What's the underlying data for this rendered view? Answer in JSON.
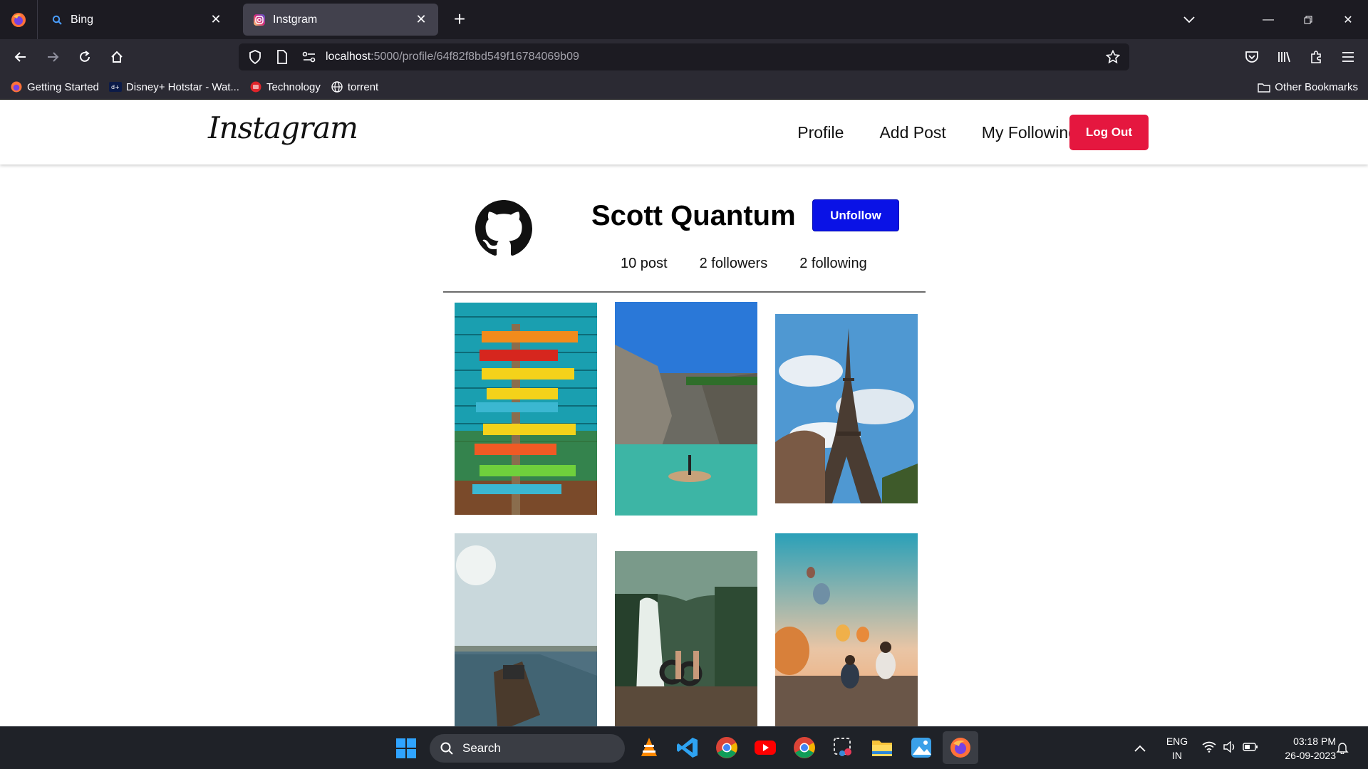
{
  "browser": {
    "tabs": [
      {
        "title": "Bing",
        "active": false
      },
      {
        "title": "Instgram",
        "active": true
      }
    ],
    "url": {
      "host": "localhost",
      "rest": ":5000/profile/64f82f8bd549f16784069b09"
    },
    "bookmarks": [
      {
        "label": "Getting Started",
        "icon": "firefox-icon"
      },
      {
        "label": "Disney+ Hotstar - Wat...",
        "icon": "hotstar-icon"
      },
      {
        "label": "Technology",
        "icon": "technology-icon"
      },
      {
        "label": "torrent",
        "icon": "globe-icon"
      }
    ],
    "other_bookmarks": "Other Bookmarks"
  },
  "app": {
    "logo": "Instagram",
    "menu": {
      "profile": "Profile",
      "add_post": "Add Post",
      "my_following": "My Following"
    },
    "logout_label": "Log Out"
  },
  "profile": {
    "name": "Scott Quantum",
    "unfollow_label": "Unfollow",
    "stats": {
      "posts": "10 post",
      "followers": "2 followers",
      "following": "2 following"
    },
    "avatar_icon": "github-icon"
  },
  "posts": [
    {
      "subject": "signpost"
    },
    {
      "subject": "lagoon"
    },
    {
      "subject": "eiffel-tower"
    },
    {
      "subject": "boat"
    },
    {
      "subject": "waterfall"
    },
    {
      "subject": "balloons"
    }
  ],
  "taskbar": {
    "search_label": "Search",
    "lang": "ENG",
    "region": "IN",
    "time": "03:18 PM",
    "date": "26-09-2023"
  },
  "colors": {
    "logout": "#e5173f",
    "unfollow": "#0a12e6"
  }
}
